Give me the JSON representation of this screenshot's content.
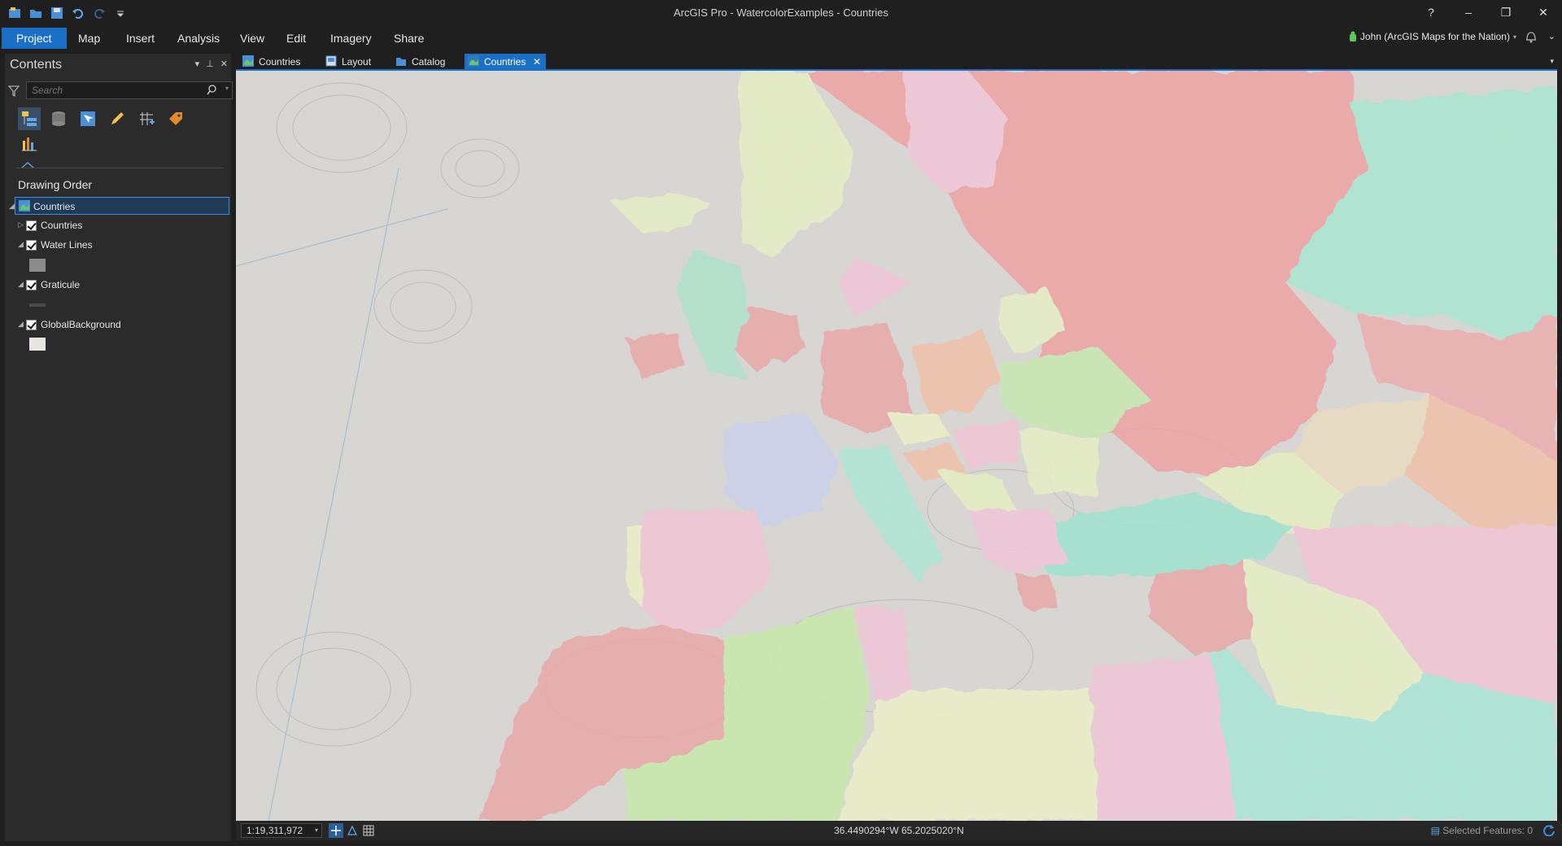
{
  "app": {
    "title": "ArcGIS Pro - WatercolorExamples - Countries",
    "window_controls": {
      "help": "?",
      "minimize": "–",
      "restore": "❐",
      "close": "✕"
    }
  },
  "ribbon": {
    "tabs": [
      "Project",
      "Map",
      "Insert",
      "Analysis",
      "View",
      "Edit",
      "Imagery",
      "Share"
    ],
    "active": "Project",
    "user": "John (ArcGIS Maps for the Nation)"
  },
  "contents": {
    "title": "Contents",
    "search_placeholder": "Search",
    "heading": "Drawing Order",
    "map_item": "Countries",
    "layers": [
      {
        "name": "Countries",
        "checked": true,
        "expanded": false
      },
      {
        "name": "Water Lines",
        "checked": true,
        "expanded": true,
        "swatch": "#8c8c8c"
      },
      {
        "name": "Graticule",
        "checked": true,
        "expanded": true,
        "swatch": "#4a4a4a"
      },
      {
        "name": "GlobalBackground",
        "checked": true,
        "expanded": true,
        "swatch": "#e8e6e2"
      }
    ]
  },
  "view_tabs": {
    "tabs": [
      "Countries",
      "Layout",
      "Catalog",
      "Countries"
    ],
    "active_index": 3
  },
  "status_bar": {
    "scale": "1:19,311,972",
    "coordinates": "36.4490294°W 65.2025020°N",
    "selected_features": "Selected Features: 0"
  },
  "colors": {
    "accent": "#1a6fc7",
    "background": "#1f1f1f",
    "pane": "#2b2b2b",
    "map_base": "#d8d6d2"
  }
}
